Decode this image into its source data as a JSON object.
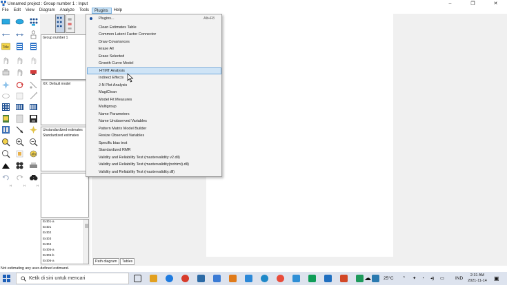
{
  "window": {
    "title": "Unnamed project : Group number 1 : Input",
    "controls": {
      "minimize": "–",
      "maximize": "❐",
      "close": "✕"
    }
  },
  "menubar": {
    "items": [
      "File",
      "Edit",
      "View",
      "Diagram",
      "Analyze",
      "Tools",
      "Plugins",
      "Help"
    ],
    "active": "Plugins"
  },
  "left_panels": {
    "group": "Group number 1",
    "model": "XX: Default model",
    "estimates": [
      "Unstandardized estimates",
      "Standardized estimates"
    ],
    "variables": [
      "Ext01-a",
      "Ext01",
      "Ext02",
      "Ext03",
      "Ext04",
      "Ext05-a",
      "Ext05-b",
      "Ext06-a"
    ],
    "toolbox_tiny_labels": [
      "H",
      "H",
      "H"
    ]
  },
  "plugins_menu": {
    "items": [
      {
        "label": "Plugins...",
        "shortcut": "Alt+F8",
        "radio": true
      },
      {
        "label": "Clean Estimates Table"
      },
      {
        "label": "Common Latent Factor Connector"
      },
      {
        "label": "Draw Covariances"
      },
      {
        "label": "Erase All"
      },
      {
        "label": "Erase Selected"
      },
      {
        "label": "Growth Curve Model"
      },
      {
        "label": "HTMT Analysis",
        "highlighted": true
      },
      {
        "label": "Indirect Effects"
      },
      {
        "label": "J-N Plot Analysis"
      },
      {
        "label": "MagiClean"
      },
      {
        "label": "Model Fit Measures"
      },
      {
        "label": "Multigroup"
      },
      {
        "label": "Name Parameters"
      },
      {
        "label": "Name Unobserved Variables"
      },
      {
        "label": "Pattern Matrix Model Builder"
      },
      {
        "label": "Resize Observed Variables"
      },
      {
        "label": "Specific bias test"
      },
      {
        "label": "Standardized RMR"
      },
      {
        "label": "Validity and Reliability Test (mastervalidity v2.dll)"
      },
      {
        "label": "Validity and Reliability Test (mastervalidity(nohtmt).dll)"
      },
      {
        "label": "Validity and Reliability Test (mastervalidity.dll)"
      }
    ]
  },
  "tabs": [
    "Path diagram",
    "Tables"
  ],
  "status": "Not estimating any user-defined estimand.",
  "taskbar": {
    "search_placeholder": "Ketik di sini untuk mencari",
    "temperature": "25°C",
    "language": "IND",
    "time": "2:31 AM",
    "date": "2021-11-14",
    "icon_colors": [
      "#3b78c2",
      "#e2a020",
      "#1e7be0",
      "#d83b2b",
      "#2b6aa6",
      "#3a7bd5",
      "#e07b1a",
      "#2b88d8",
      "#1e88c8",
      "#e94c3b",
      "#2f8fd6",
      "#0f9d58",
      "#1f6fc0",
      "#d24726",
      "#1d9a5b",
      "#2a7ab0"
    ]
  }
}
